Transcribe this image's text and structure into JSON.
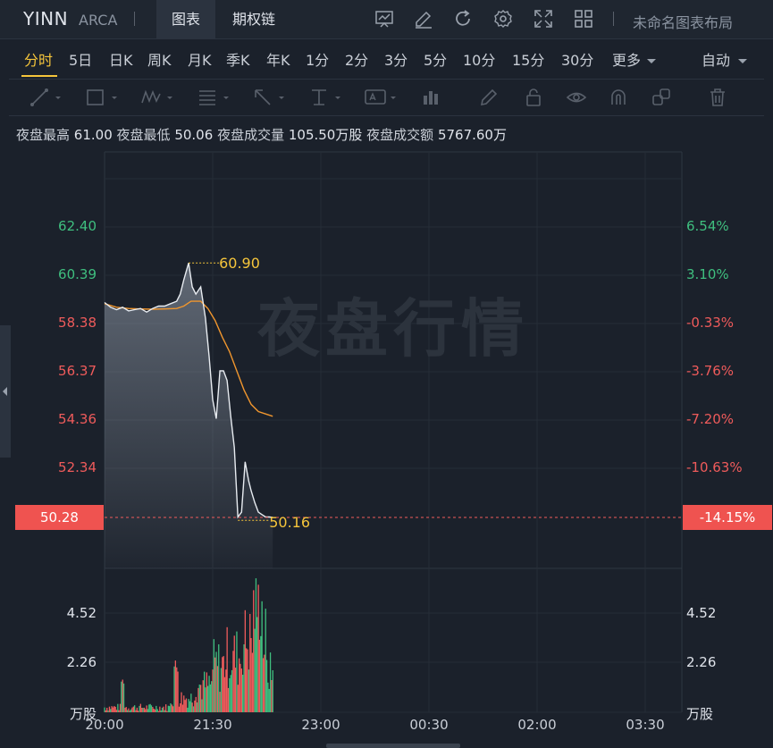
{
  "header": {
    "ticker": "YINN",
    "exchange": "ARCA",
    "tabs": [
      {
        "label": "图表",
        "active": true
      },
      {
        "label": "期权链",
        "active": false
      }
    ],
    "toolbar_icons": [
      "chart-template-icon",
      "edit-icon",
      "refresh-icon",
      "settings-icon",
      "fullscreen-icon",
      "grid-layout-icon"
    ],
    "layout_label": "未命名图表布局"
  },
  "timeframes": {
    "items": [
      "分时",
      "5日",
      "日K",
      "周K",
      "月K",
      "季K",
      "年K",
      "1分",
      "2分",
      "3分",
      "5分",
      "10分",
      "15分",
      "30分"
    ],
    "active": "分时",
    "more_label": "更多",
    "auto_label": "自动"
  },
  "drawing_tools": [
    "trend-line-icon",
    "rectangle-icon",
    "pattern-icon",
    "fib-icon",
    "arrow-icon",
    "text-align-icon",
    "text-icon",
    "bar-pattern-icon",
    "pencil-icon",
    "lock-icon",
    "eye-icon",
    "magnet-icon",
    "group-icon",
    "trash-icon"
  ],
  "stats": {
    "high_label": "夜盘最高",
    "high_value": "61.00",
    "low_label": "夜盘最低",
    "low_value": "50.06",
    "volume_label": "夜盘成交量",
    "volume_value": "105.50万股",
    "amount_label": "夜盘成交额",
    "amount_value": "5767.60万"
  },
  "watermark": "夜盘行情",
  "colors": {
    "up": "#3fbf7f",
    "down": "#ef5b5b",
    "accent": "#f5c53b",
    "avg_line": "#f0962e",
    "last_price_bg": "#ef5350"
  },
  "chart_data": {
    "type": "line",
    "price_axis": {
      "ticks": [
        "62.40",
        "60.39",
        "58.38",
        "56.37",
        "54.36",
        "52.34"
      ],
      "pct_ticks": [
        "6.54%",
        "3.10%",
        "-0.33%",
        "-3.76%",
        "-7.20%",
        "-10.63%"
      ],
      "ylim": [
        50.28,
        62.4
      ]
    },
    "last_price": "50.28",
    "last_pct": "-14.15%",
    "max_marker": "60.90",
    "min_marker": "50.16",
    "x_ticks": [
      "20:00",
      "21:30",
      "23:00",
      "00:30",
      "02:00",
      "03:30"
    ],
    "volume_axis": {
      "ticks": [
        "4.52",
        "2.26"
      ],
      "unit": "万股"
    },
    "series": [
      {
        "x": [
          0,
          1,
          2,
          3,
          4,
          5,
          6,
          7,
          8,
          9,
          10,
          11,
          12,
          13,
          14,
          15,
          16,
          17,
          18,
          19,
          20,
          21,
          22,
          23,
          24,
          25,
          26,
          27,
          28,
          29,
          30,
          31,
          32,
          33,
          34,
          35,
          36,
          37,
          38,
          39,
          40,
          41,
          42,
          43,
          44,
          45,
          46,
          47,
          48,
          49,
          50,
          51,
          52,
          53,
          54,
          55,
          56,
          57,
          58,
          59,
          60,
          61,
          62,
          63,
          64,
          65,
          66,
          67,
          68,
          69,
          70,
          71,
          72,
          73,
          74,
          75,
          76,
          77,
          78,
          79,
          80,
          81,
          82,
          83,
          84,
          85,
          86,
          87,
          88,
          89,
          90,
          91,
          92,
          93,
          94,
          95,
          96,
          97,
          98,
          99,
          100,
          101,
          102,
          103,
          104,
          105,
          106,
          107,
          108,
          109,
          110,
          111,
          112,
          113,
          114,
          115,
          116,
          117,
          118,
          119,
          120,
          121,
          122,
          123,
          124,
          125,
          126,
          127,
          128,
          129,
          130,
          131,
          132,
          133,
          134,
          135,
          136,
          137,
          138,
          139,
          140,
          141,
          142,
          143,
          144,
          145,
          146,
          147,
          148,
          149,
          150,
          151,
          152,
          153,
          154,
          155,
          156,
          157,
          158,
          159,
          160,
          161,
          162,
          163,
          164,
          165,
          166,
          167,
          168,
          169,
          170,
          171,
          172,
          173,
          174,
          175,
          176,
          177,
          178,
          179,
          180,
          181,
          182,
          183,
          184,
          185,
          186,
          187,
          188,
          189,
          190,
          191,
          192,
          193,
          194,
          195,
          196,
          197,
          198,
          199,
          200,
          201,
          202,
          203,
          204,
          205,
          206,
          207,
          208,
          209,
          210,
          211,
          212,
          213,
          214,
          215,
          216,
          217,
          218,
          219,
          220,
          221,
          222,
          223,
          224,
          225,
          226,
          227,
          228,
          229,
          230,
          231,
          232,
          233,
          234,
          235,
          236,
          237,
          238,
          239,
          240,
          241,
          242,
          243,
          244,
          245,
          246,
          247,
          248,
          249,
          250,
          251,
          252,
          253,
          254,
          255,
          256,
          257,
          258,
          259,
          260,
          261,
          262,
          263,
          264,
          265,
          266,
          267,
          268,
          269,
          270,
          271,
          272,
          273,
          274,
          275,
          276,
          277,
          278,
          279,
          280,
          281,
          282,
          283,
          284,
          285,
          286,
          287,
          288,
          289,
          290,
          291,
          292,
          293,
          294,
          295,
          296,
          297,
          298,
          299,
          300,
          301,
          302,
          303,
          304,
          305,
          306,
          307,
          308,
          309,
          310,
          311,
          312,
          313,
          314,
          315,
          316,
          317,
          318,
          319,
          320,
          321,
          322,
          323,
          324,
          325,
          326,
          327,
          328,
          329,
          330,
          331,
          332,
          333,
          334,
          335,
          336,
          337,
          338,
          339,
          340,
          341,
          342,
          343,
          344,
          345,
          346,
          347,
          348,
          349,
          350,
          351,
          352,
          353,
          354,
          355,
          356,
          357,
          358,
          359,
          360,
          361,
          362,
          363,
          364,
          365,
          366,
          367,
          368,
          369,
          370,
          371,
          372,
          373,
          374,
          375,
          376,
          377,
          378,
          379,
          380,
          381,
          382,
          383,
          384,
          385,
          386,
          387,
          388,
          389,
          390,
          391,
          392,
          393,
          394,
          395,
          396,
          397,
          398,
          399,
          400,
          401,
          402,
          403,
          404,
          405,
          406,
          407,
          408,
          409,
          410,
          411,
          412,
          413,
          414,
          415,
          416,
          417,
          418,
          419,
          420,
          421,
          422,
          423,
          424,
          425,
          426,
          427,
          428,
          429,
          430,
          431,
          432,
          433,
          434,
          435,
          436,
          437,
          438,
          439,
          440,
          441,
          442,
          443,
          444,
          445,
          446,
          447,
          448,
          449,
          450,
          451,
          452,
          453,
          454,
          455,
          456,
          457,
          458,
          459,
          460,
          461,
          462,
          463,
          464,
          465,
          466,
          467,
          468,
          469,
          470,
          471,
          472,
          473,
          474,
          475,
          476,
          477,
          478,
          479,
          480,
          481,
          482,
          483,
          484,
          485,
          486,
          487,
          488,
          489,
          490,
          491,
          492,
          493,
          494,
          495,
          496,
          497,
          498,
          499,
          500,
          501,
          502,
          503,
          504,
          505,
          506,
          507,
          508,
          509,
          510,
          511,
          512,
          513,
          514,
          515,
          516,
          517,
          518,
          519,
          520,
          521,
          522,
          523,
          524,
          525,
          526,
          527,
          528,
          529,
          530,
          531,
          532,
          533,
          534,
          535,
          536,
          537,
          538,
          539
        ],
        "price_minutes": [
          0,
          5,
          10,
          15,
          20,
          25,
          30,
          35,
          40,
          45,
          50,
          55,
          60,
          63,
          66,
          70,
          73,
          76,
          80,
          84,
          87,
          90,
          93,
          96,
          99,
          102,
          105,
          108,
          111,
          114,
          117,
          120,
          122,
          125,
          128,
          131,
          134,
          137,
          140
        ],
        "price": [
          59.25,
          59.05,
          58.95,
          59.05,
          58.9,
          58.95,
          59.0,
          58.85,
          59.0,
          59.1,
          59.1,
          59.2,
          59.3,
          59.6,
          60.2,
          60.9,
          59.9,
          59.6,
          59.9,
          58.6,
          57.0,
          55.2,
          54.4,
          56.4,
          56.4,
          56.0,
          54.5,
          53.2,
          50.3,
          50.5,
          52.6,
          51.8,
          51.4,
          50.9,
          50.5,
          50.4,
          50.3,
          50.3,
          50.28
        ],
        "avg_minutes": [
          0,
          10,
          20,
          30,
          40,
          50,
          60,
          66,
          72,
          80,
          86,
          92,
          98,
          104,
          110,
          116,
          122,
          128,
          134,
          140
        ],
        "avg": [
          59.2,
          59.05,
          59.0,
          58.98,
          58.97,
          58.98,
          59.0,
          59.1,
          59.3,
          59.3,
          59.0,
          58.5,
          57.8,
          57.2,
          56.4,
          55.6,
          55.0,
          54.7,
          54.6,
          54.5
        ]
      }
    ]
  }
}
